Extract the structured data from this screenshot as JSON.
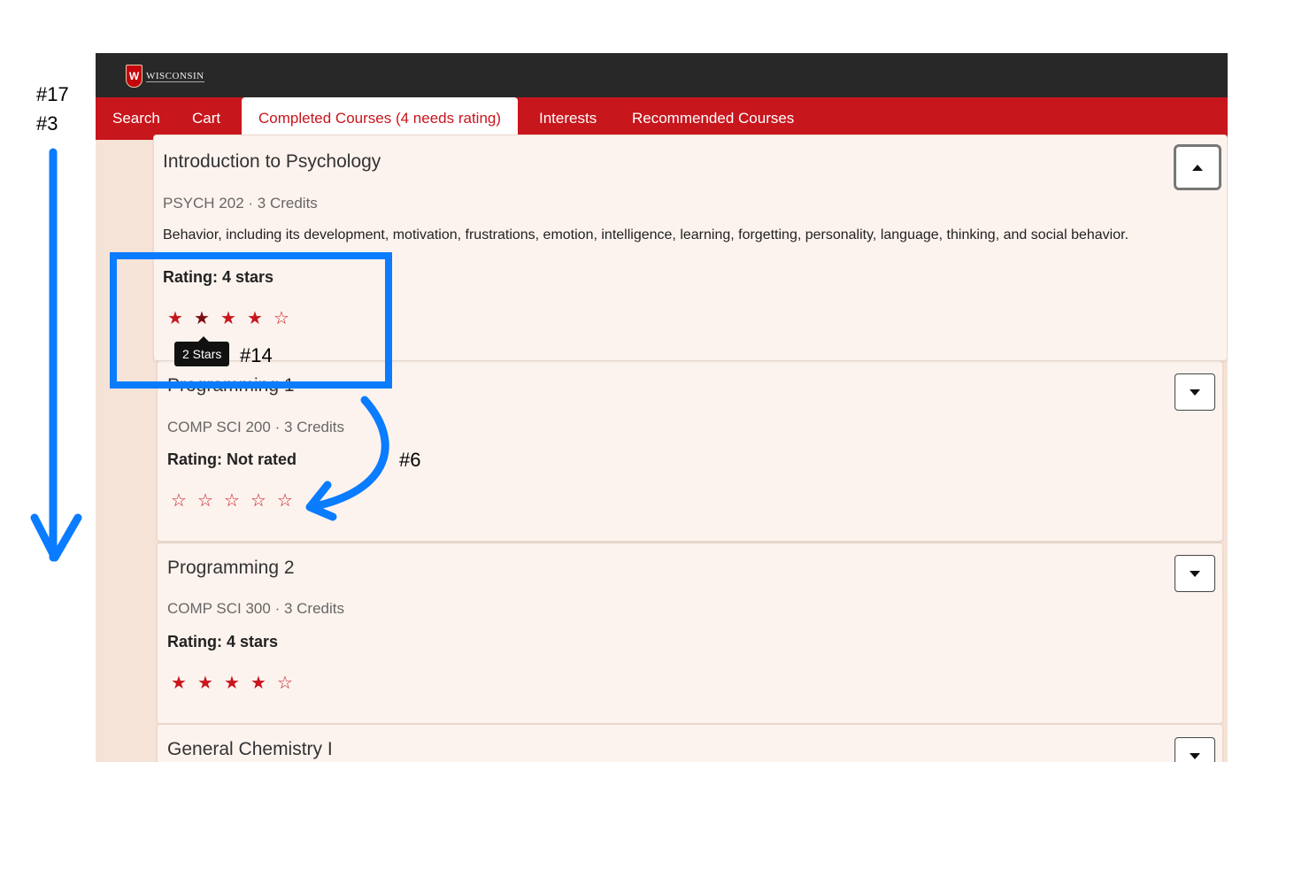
{
  "annotations": {
    "step_a": "#17",
    "step_b": "#3",
    "tooltip_step": "#14",
    "arrow_step": "#6",
    "color": "#0a7cff"
  },
  "header": {
    "logo_text": "WISCONSIN",
    "crest_letter": "W"
  },
  "nav": {
    "tabs": [
      {
        "label": "Search"
      },
      {
        "label": "Cart"
      },
      {
        "label": "Completed Courses (4 needs rating)",
        "active": true
      },
      {
        "label": "Interests"
      },
      {
        "label": "Recommended Courses"
      }
    ]
  },
  "courses": [
    {
      "title": "Introduction to Psychology",
      "meta": "PSYCH 202 · 3 Credits",
      "description": "Behavior, including its development, motivation, frustrations, emotion, intelligence, learning, forgetting, personality, language, thinking, and social behavior.",
      "rating_label": "Rating: 4 stars",
      "rating": 4,
      "expanded": true,
      "toggle_icon": "caret-up-icon"
    },
    {
      "title": "Programming 1",
      "meta": "COMP SCI 200 · 3 Credits",
      "rating_label": "Rating: Not rated",
      "rating": 0,
      "expanded": false,
      "toggle_icon": "caret-down-icon"
    },
    {
      "title": "Programming 2",
      "meta": "COMP SCI 300 · 3 Credits",
      "rating_label": "Rating: 4 stars",
      "rating": 4,
      "expanded": false,
      "toggle_icon": "caret-down-icon"
    },
    {
      "title": "General Chemistry I",
      "expanded": false,
      "toggle_icon": "caret-down-icon"
    }
  ],
  "tooltip": {
    "text": "2 Stars"
  },
  "colors": {
    "brand_red": "#c8161d",
    "topbar": "#282828",
    "card_bg": "#fdf3ee",
    "page_bg": "#f6e3d7"
  }
}
